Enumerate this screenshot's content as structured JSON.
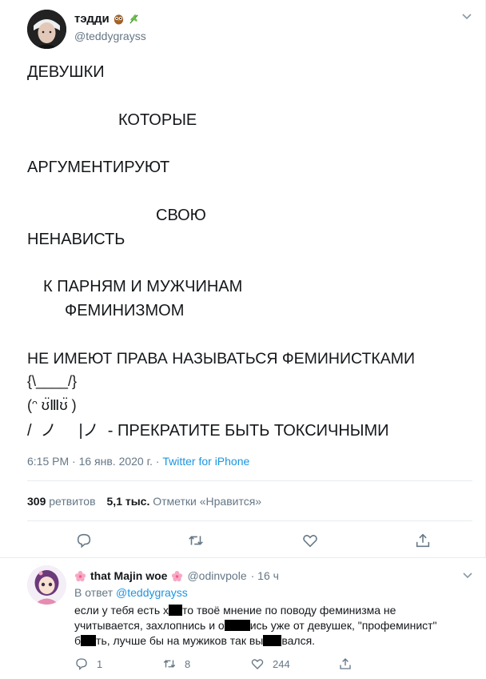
{
  "tweet": {
    "author_name": "тэдди",
    "author_handle": "@teddygrayss",
    "name_emojis": [
      "owl-emoji",
      "herb-emoji"
    ],
    "lines": [
      "ДЕВУШКИ",
      "КОТОРЫЕ",
      "АРГУМЕНТИРУЮТ",
      "СВОЮ",
      "НЕНАВИСТЬ",
      "К ПАРНЯМ И МУЖЧИНАМ",
      "ФЕМИНИЗМОМ",
      "НЕ ИМЕЮТ ПРАВА НАЗЫВАТЬСЯ ФЕМИНИСТКАМИ",
      "{\\____/}",
      "(ᵔ ʊ̈Ⅲʊ̈ )",
      "/  ノ     |ノ  - ПРЕКРАТИТЕ БЫТЬ ТОКСИЧНЫМИ"
    ],
    "time": "6:15 PM · 16 янв. 2020 г. · ",
    "source": "Twitter for iPhone",
    "retweets_count": "309",
    "retweets_label": "ретвитов",
    "likes_count": "5,1 тыс.",
    "likes_label": "Отметки «Нравится»",
    "actions": [
      "reply-icon",
      "retweet-icon",
      "like-icon",
      "share-icon"
    ]
  },
  "reply": {
    "author_name": "that Majin woe",
    "name_emojis": [
      "cherry-blossom-emoji",
      "cherry-blossom-emoji"
    ],
    "author_handle": "@odinvpole",
    "time": "· 16 ч",
    "reply_to_prefix": "В ответ ",
    "reply_to_handle": "@teddygrayss",
    "text_1a": "если у тебя есть х",
    "text_1b": "то твоё мнение по поводу феминизма не",
    "text_2a": "учитывается, захлопнись и о",
    "text_2b": "ись уже от девушек, \"профеминист\"",
    "text_3a": "б",
    "text_3b": "ть, лучше бы на мужиков так вы",
    "text_3c": "вался.",
    "reply_count": "1",
    "retweet_count": "8",
    "like_count": "244"
  },
  "colors": {
    "accent": "#1b95e0",
    "secondary_text": "#657786",
    "divider": "#e6ecf0"
  }
}
